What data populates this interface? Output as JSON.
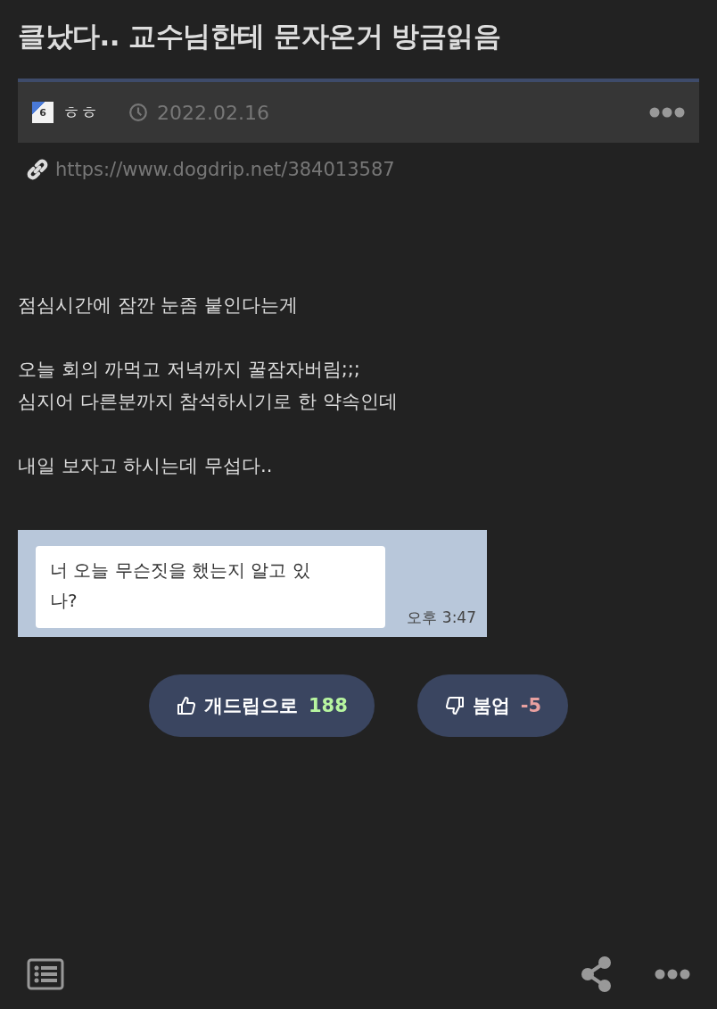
{
  "title": "클났다.. 교수님한테 문자온거 방금읽음",
  "meta": {
    "level_badge": "6",
    "author": "ㅎㅎ",
    "date": "2022.02.16",
    "url": "https://www.dogdrip.net/384013587"
  },
  "body": [
    [
      "점심시간에 잠깐 눈좀 붙인다는게"
    ],
    [
      "오늘 회의 까먹고 저녁까지 꿀잠자버림;;;",
      "심지어 다른분까지 참석하시기로 한 약속인데"
    ],
    [
      "내일 보자고 하시는데 무섭다.."
    ]
  ],
  "chat_screenshot": {
    "message": "너 오늘 무슨짓을 했는지 알고 있\n나?",
    "time": "오후 3:47"
  },
  "votes": [
    {
      "kind": "up",
      "label": "개드립으로",
      "count": "188"
    },
    {
      "kind": "down",
      "label": "붐업",
      "count": "-5"
    }
  ]
}
